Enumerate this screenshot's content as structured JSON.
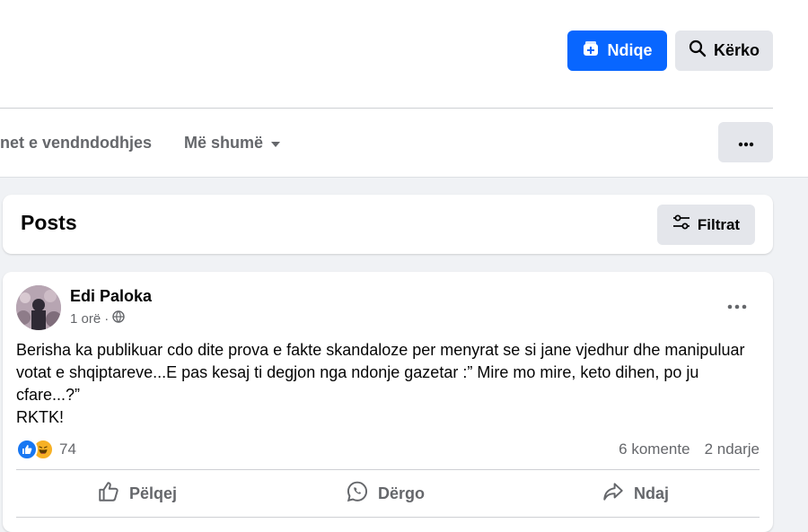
{
  "header": {
    "follow_label": "Ndiqe",
    "search_label": "Kërko",
    "colors": {
      "primary": "#0866ff",
      "secondary_bg": "#e4e6eb"
    }
  },
  "tabs": {
    "location_label": "net e vendndodhjes",
    "more_label": "Më shumë"
  },
  "posts_section": {
    "title": "Posts",
    "filter_label": "Filtrat"
  },
  "post": {
    "author": "Edi Paloka",
    "time": "1 orë",
    "text": "Berisha ka publikuar cdo dite prova e fakte skandaloze per menyrat se si jane vjedhur dhe manipuluar votat e shqiptareve...E pas kesaj ti degjon nga ndonje gazetar :” Mire mo mire, keto dihen, po ju cfare...?”\nRKTK!",
    "reaction_count": "74",
    "comments": "6 komente",
    "shares": "2 ndarje",
    "actions": {
      "like": "Pëlqej",
      "send": "Dërgo",
      "share": "Ndaj"
    }
  }
}
